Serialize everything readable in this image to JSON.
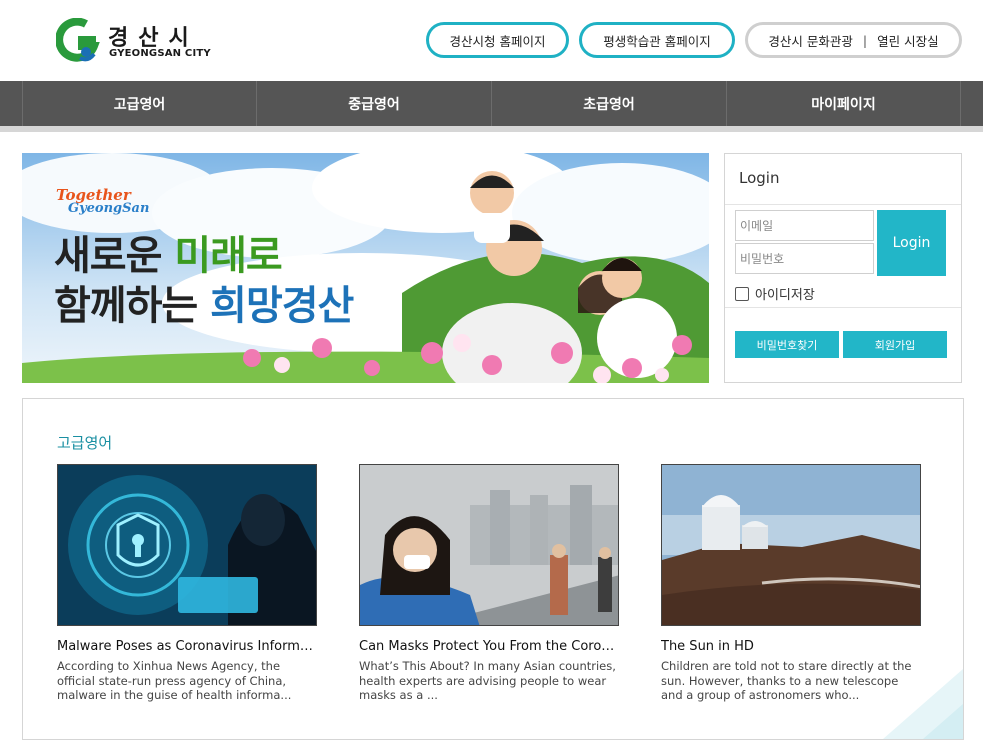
{
  "header": {
    "logo_ko": "경산시",
    "logo_en": "GYEONGSAN CITY",
    "links": {
      "city_home": "경산시청 홈페이지",
      "learning_home": "평생학습관 홈페이지",
      "culture": "경산시 문화관광",
      "separator": "|",
      "mayor": "열린 시장실"
    }
  },
  "nav": {
    "items": [
      "고급영어",
      "중급영어",
      "초급영어",
      "마이페이지"
    ]
  },
  "banner": {
    "brand_line1": "Together",
    "brand_line2": "GyeongSan",
    "slogan_1a": "새로운 ",
    "slogan_1b": "미래로",
    "slogan_2a": "함께하는 ",
    "slogan_2b": "희망경산"
  },
  "login": {
    "title": "Login",
    "email_placeholder": "이메일",
    "password_placeholder": "비밀번호",
    "submit_label": "Login",
    "remember_label": "아이디저장",
    "find_password": "비밀번호찾기",
    "join": "회원가입"
  },
  "section": {
    "title": "고급영어",
    "cards": [
      {
        "title": "Malware Poses as Coronavirus Information",
        "desc": "According to Xinhua News Agency, the official state-run press agency of China, malware in the guise of health informa..."
      },
      {
        "title": "Can Masks Protect You From the Coronavirus?",
        "desc": "What’s This About?  In many Asian countries, health experts are advising people to wear masks as a ..."
      },
      {
        "title": "The Sun in HD",
        "desc": "Children are told not to stare directly at the sun. However, thanks to a new telescope and a group of astronomers who..."
      }
    ]
  },
  "colors": {
    "accent": "#22b6c8",
    "nav_bg": "#555555",
    "section_title": "#1a8fa2"
  }
}
